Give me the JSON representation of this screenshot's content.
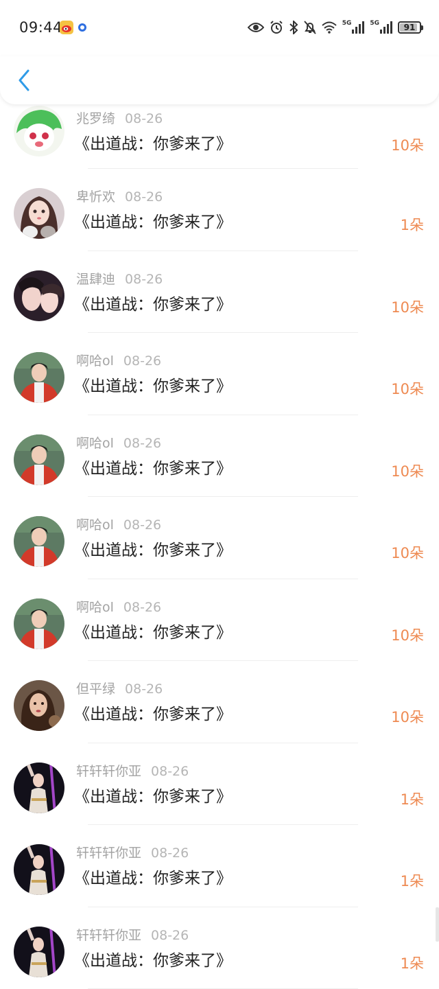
{
  "status_bar": {
    "time": "09:44",
    "network_left": "5G",
    "network_right": "5G",
    "battery": "91",
    "battery_level": 0.91
  },
  "nav": {
    "back_icon": "chevron-left-icon",
    "accent": "#2f9be8"
  },
  "colors": {
    "gift_text": "#ee8a52",
    "meta_text": "#a3a3a3"
  },
  "rows": [
    {
      "user": "兆罗绮",
      "date": "08-26",
      "title": "《出道战：你爹来了》",
      "gift": "10朵",
      "avatar": "green-cartoon-avatar"
    },
    {
      "user": "卑忻欢",
      "date": "08-26",
      "title": "《出道战：你爹来了》",
      "gift": "1朵",
      "avatar": "girl-with-cat-avatar"
    },
    {
      "user": "温肆迪",
      "date": "08-26",
      "title": "《出道战：你爹来了》",
      "gift": "10朵",
      "avatar": "two-girls-avatar"
    },
    {
      "user": "啊哈ol",
      "date": "08-26",
      "title": "《出道战：你爹来了》",
      "gift": "10朵",
      "avatar": "boy-red-jacket-avatar"
    },
    {
      "user": "啊哈ol",
      "date": "08-26",
      "title": "《出道战：你爹来了》",
      "gift": "10朵",
      "avatar": "boy-red-jacket-avatar"
    },
    {
      "user": "啊哈ol",
      "date": "08-26",
      "title": "《出道战：你爹来了》",
      "gift": "10朵",
      "avatar": "boy-red-jacket-avatar"
    },
    {
      "user": "啊哈ol",
      "date": "08-26",
      "title": "《出道战：你爹来了》",
      "gift": "10朵",
      "avatar": "boy-red-jacket-avatar"
    },
    {
      "user": "但平绿",
      "date": "08-26",
      "title": "《出道战：你爹来了》",
      "gift": "10朵",
      "avatar": "woman-portrait-avatar"
    },
    {
      "user": "轩轩轩你亚",
      "date": "08-26",
      "title": "《出道战：你爹来了》",
      "gift": "1朵",
      "avatar": "dancer-avatar"
    },
    {
      "user": "轩轩轩你亚",
      "date": "08-26",
      "title": "《出道战：你爹来了》",
      "gift": "1朵",
      "avatar": "dancer-avatar"
    },
    {
      "user": "轩轩轩你亚",
      "date": "08-26",
      "title": "《出道战：你爹来了》",
      "gift": "1朵",
      "avatar": "dancer-avatar"
    }
  ]
}
